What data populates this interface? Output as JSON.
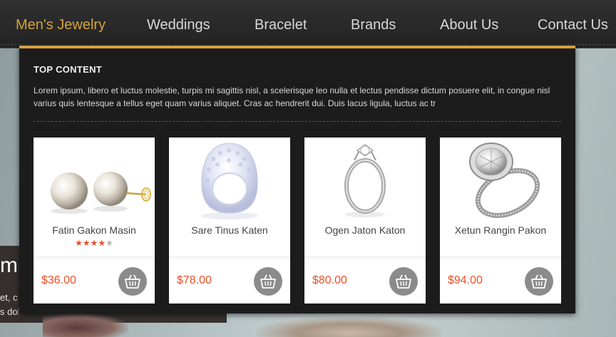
{
  "nav": {
    "items": [
      {
        "label": "Men's Jewelry",
        "active": true
      },
      {
        "label": "Weddings",
        "active": false
      },
      {
        "label": "Bracelet",
        "active": false
      },
      {
        "label": "Brands",
        "active": false
      },
      {
        "label": "About Us",
        "active": false
      },
      {
        "label": "Contact Us",
        "active": false
      }
    ]
  },
  "mega_menu": {
    "heading": "TOP CONTENT",
    "description": "Lorem ipsum, libero et luctus molestie, turpis mi sagittis nisl, a scelerisque leo nulla et lectus pendisse dictum posuere elit, in congue nisl varius quis lentesque a tellus eget quam varius aliquet. Cras ac hendrerit dui. Duis lacus ligula, luctus ac tr",
    "products": [
      {
        "name": "Fatin Gakon Masin",
        "price": "$36.00",
        "rating": 4,
        "rating_max": 5,
        "image": "pearl-earrings"
      },
      {
        "name": "Sare Tinus Katen",
        "price": "$78.00",
        "image": "crystal-ring"
      },
      {
        "name": "Ogen Jaton Katon",
        "price": "$80.00",
        "image": "solitaire-ring"
      },
      {
        "name": "Xetun Rangin Pakon",
        "price": "$94.00",
        "image": "halo-engagement-ring"
      }
    ]
  },
  "hero": {
    "title_fragment": "m a",
    "text_line1": "et, c",
    "text_line2": "s dol"
  },
  "colors": {
    "accent": "#d4a23c",
    "price": "#e8502a",
    "menu_bg": "#1c1c1c",
    "cart_button": "#8b8b8b"
  }
}
